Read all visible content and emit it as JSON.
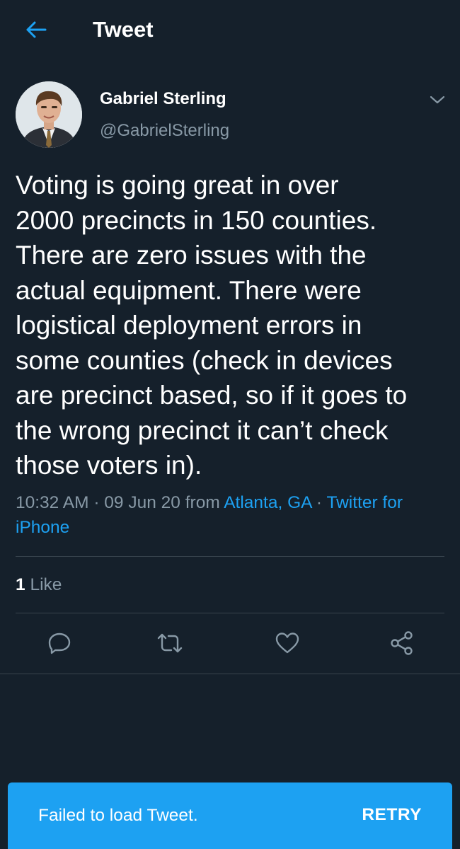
{
  "header": {
    "title": "Tweet",
    "back_icon": "arrow-left-icon"
  },
  "author": {
    "name": "Gabriel Sterling",
    "handle": "@GabrielSterling",
    "avatar_icon": "profile-photo",
    "menu_icon": "chevron-down-icon"
  },
  "tweet": {
    "text": "Voting is going great in over\n2000 precincts in 150 counties.\nThere are zero issues with the\nactual equipment. There were\nlogistical deployment errors in\nsome counties (check in devices\nare precinct based, so if it goes to\nthe wrong precinct it can’t check\nthose voters in).",
    "time": "10:32 AM",
    "separator": " · ",
    "date": "09 Jun 20",
    "from_text": " from ",
    "location": "Atlanta, GA",
    "source": "Twitter for iPhone"
  },
  "engagement": {
    "like_count": "1",
    "like_label": " Like"
  },
  "actions": [
    {
      "name": "reply",
      "icon": "reply-icon"
    },
    {
      "name": "retweet",
      "icon": "retweet-icon"
    },
    {
      "name": "like",
      "icon": "heart-icon"
    },
    {
      "name": "share",
      "icon": "share-icon"
    }
  ],
  "toast": {
    "message": "Failed to load Tweet.",
    "action_label": "RETRY"
  },
  "colors": {
    "background": "#15202b",
    "accent": "#1da1f2",
    "secondary_text": "#8899a6",
    "divider": "#38444d"
  }
}
